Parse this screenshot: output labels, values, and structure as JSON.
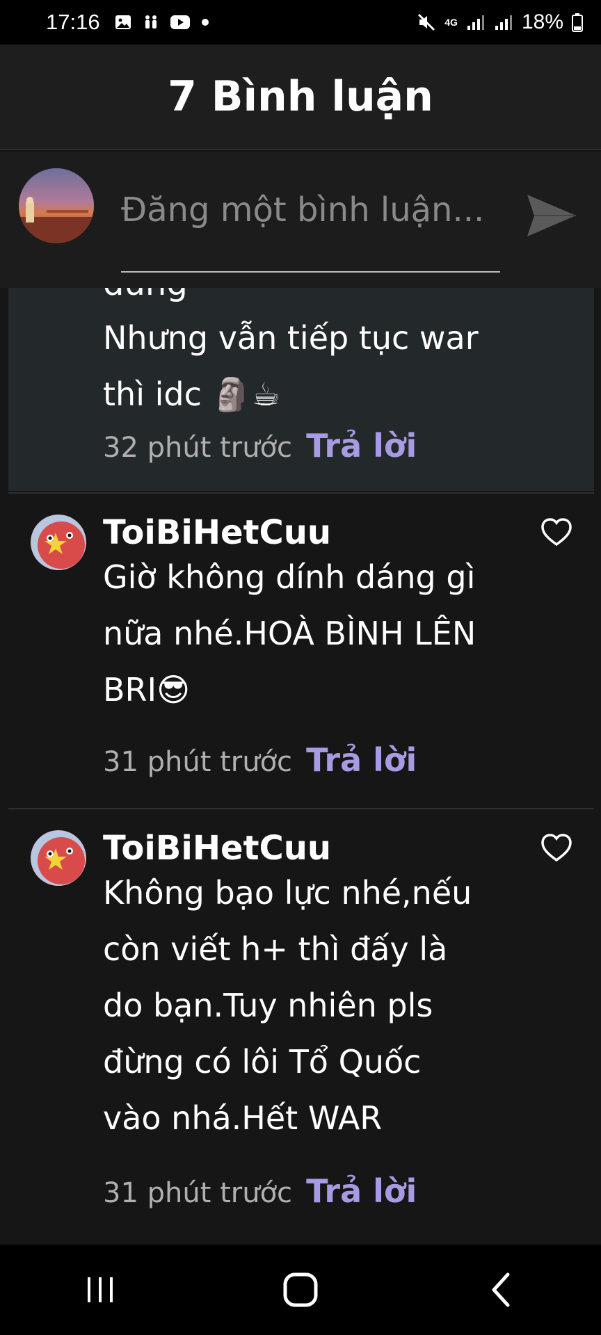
{
  "status_bar": {
    "time": "17:16",
    "battery": "18%",
    "network": "4G"
  },
  "header": {
    "title": "7 Bình luận"
  },
  "composer": {
    "placeholder": "Đăng một bình luận..."
  },
  "comments": [
    {
      "partial_top": "đúng",
      "text": "Nhưng vẫn tiếp tục war\nthì idc 🗿☕",
      "time": "32 phút trước",
      "reply_label": "Trả lời",
      "highlighted": true
    },
    {
      "author": "ToiBiHetCuu",
      "text": "Giờ không dính dáng gì\nnữa nhé.HOÀ BÌNH LÊN\nBRI😎",
      "time": "31 phút trước",
      "reply_label": "Trả lời"
    },
    {
      "author": "ToiBiHetCuu",
      "text": "Không bạo lực nhé,nếu\ncòn viết h+ thì đấy là\ndo bạn.Tuy nhiên pls\nđừng có lôi Tổ Quốc\nvào nhá.Hết WAR",
      "time": "31 phút trước",
      "reply_label": "Trả lời"
    }
  ],
  "colors": {
    "background": "#161616",
    "highlight": "#23292a",
    "reply": "#a99be3",
    "time": "#b0b0b0"
  },
  "icons": {
    "send": "send-icon",
    "like": "heart-icon",
    "nav_recent": "recent-apps-icon",
    "nav_home": "home-icon",
    "nav_back": "back-icon"
  }
}
